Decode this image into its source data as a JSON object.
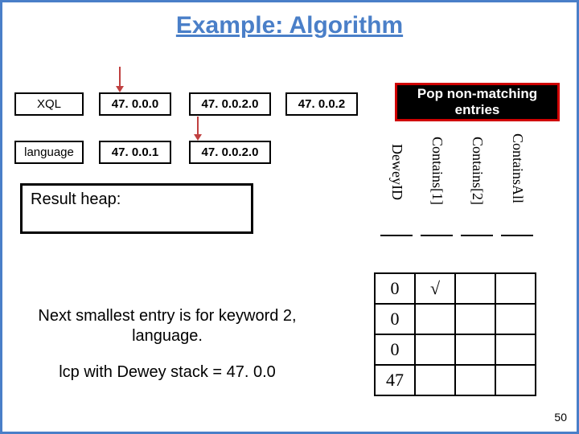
{
  "title": "Example: Algorithm",
  "row1": {
    "c0": "XQL",
    "c1": "47. 0.0.0",
    "c2": "47. 0.0.2.0",
    "c3": "47. 0.0.2"
  },
  "row2": {
    "c0": "language",
    "c1": "47. 0.0.1",
    "c2": "47. 0.0.2.0"
  },
  "pop_label": "Pop non-matching entries",
  "result_heap_label": "Result heap:",
  "headers": {
    "deweyid": "DeweyID",
    "contains1": "Contains[1]",
    "contains2": "Contains[2]",
    "containsall": "ContainsAll"
  },
  "table": [
    [
      "0",
      "√",
      "",
      ""
    ],
    [
      "0",
      "",
      "",
      ""
    ],
    [
      "0",
      "",
      "",
      ""
    ],
    [
      "47",
      "",
      "",
      ""
    ]
  ],
  "caption1": "Next smallest entry is for keyword 2, language.",
  "caption2": "lcp with Dewey stack = 47. 0.0",
  "page": "50"
}
